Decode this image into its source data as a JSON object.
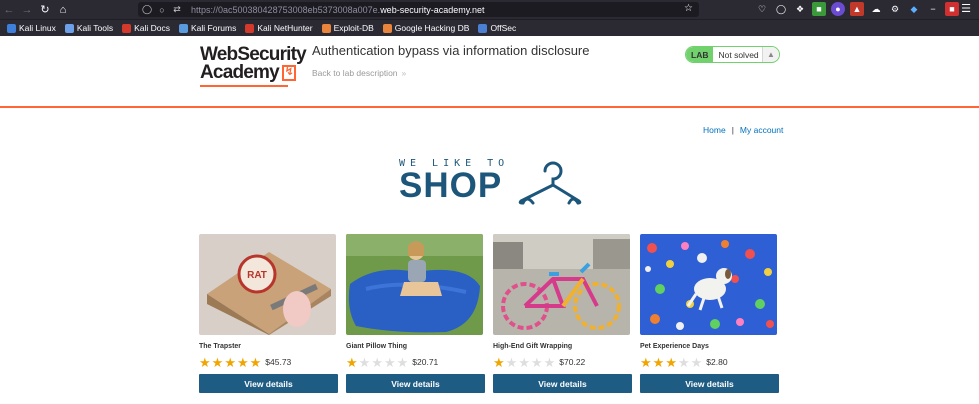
{
  "browser": {
    "url_prefix": "https://0ac500380428753008eb5373008a007e.",
    "url_host": "web-security-academy.net",
    "bookmarks": [
      {
        "label": "Kali Linux",
        "color": "#3d7fd9"
      },
      {
        "label": "Kali Tools",
        "color": "#6ca0e8"
      },
      {
        "label": "Kali Docs",
        "color": "#d33a2c"
      },
      {
        "label": "Kali Forums",
        "color": "#5a9be0"
      },
      {
        "label": "Kali NetHunter",
        "color": "#d33a2c"
      },
      {
        "label": "Exploit-DB",
        "color": "#e8843c"
      },
      {
        "label": "Google Hacking DB",
        "color": "#e8843c"
      },
      {
        "label": "OffSec",
        "color": "#4a7fd1"
      }
    ]
  },
  "header": {
    "logo_line1": "WebSecurity",
    "logo_line2": "Academy",
    "title": "Authentication bypass via information disclosure",
    "back_link": "Back to lab description",
    "lab_badge": "LAB",
    "lab_status": "Not solved"
  },
  "nav": {
    "home": "Home",
    "separator": "|",
    "account": "My account"
  },
  "banner": {
    "small": "WE LIKE TO",
    "big": "SHOP"
  },
  "products": [
    {
      "name": "The Trapster",
      "stars": 5,
      "price": "$45.73",
      "button": "View details"
    },
    {
      "name": "Giant Pillow Thing",
      "stars": 1,
      "price": "$20.71",
      "button": "View details"
    },
    {
      "name": "High-End Gift Wrapping",
      "stars": 1,
      "price": "$70.22",
      "button": "View details"
    },
    {
      "name": "Pet Experience Days",
      "stars": 3,
      "price": "$2.80",
      "button": "View details"
    }
  ],
  "colors": {
    "accent_orange": "#ff6633",
    "shop_blue": "#1d567b",
    "button_blue": "#1f5c83",
    "lab_green": "#70d16d",
    "link_blue": "#0071bc"
  }
}
